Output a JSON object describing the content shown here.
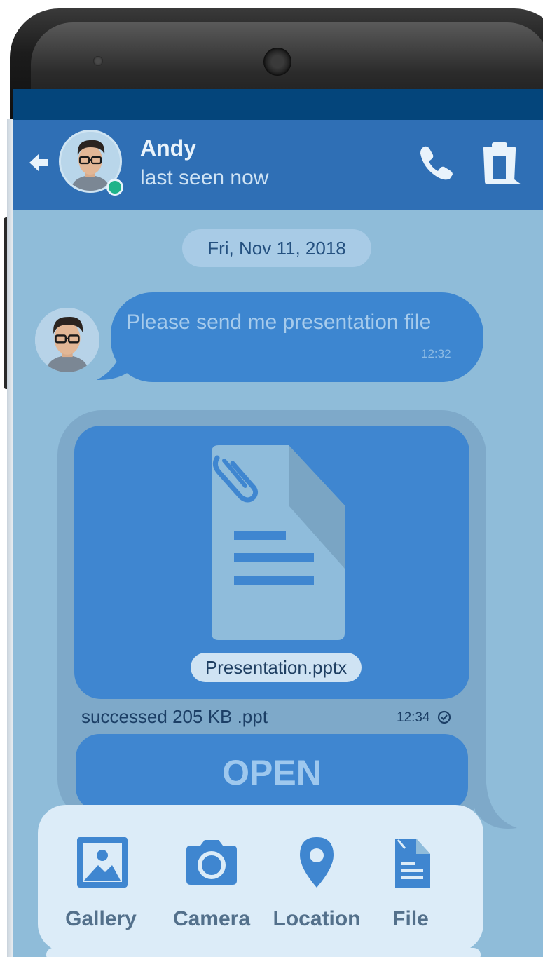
{
  "colors": {
    "header": "#2f6fb5",
    "status_bar": "#04457b",
    "chat_background": "#8fbcd9",
    "bubble": "#3d86d0",
    "panel": "#dcecf8"
  },
  "header": {
    "back_icon": "arrow-left-icon",
    "contact_name": "Andy",
    "contact_status": "last seen now",
    "call_icon": "phone-icon",
    "delete_icon": "trash-icon"
  },
  "chat": {
    "date": "Fri, Nov 11, 2018",
    "incoming": {
      "text": "Please send me presentation file",
      "time": "12:32"
    },
    "file_message": {
      "file_name": "Presentation.pptx",
      "meta": "successed 205 KB .ppt",
      "time": "12:34",
      "open_label": "OPEN"
    }
  },
  "attach_menu": {
    "items": [
      {
        "label": "Gallery",
        "icon": "image-icon"
      },
      {
        "label": "Camera",
        "icon": "camera-icon"
      },
      {
        "label": "Location",
        "icon": "location-pin-icon"
      },
      {
        "label": "File",
        "icon": "file-icon"
      }
    ]
  }
}
